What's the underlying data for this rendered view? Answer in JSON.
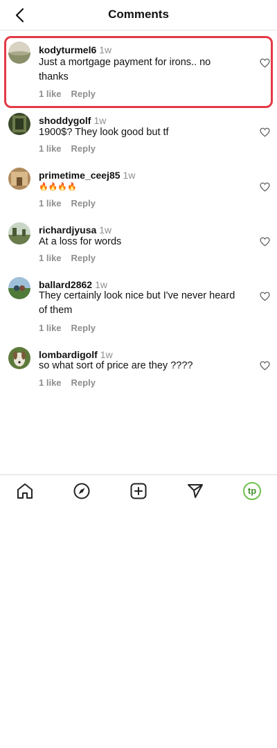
{
  "header": {
    "title": "Comments"
  },
  "comments": [
    {
      "username": "kodyturmel6",
      "time": "1w",
      "text": "Just a mortgage payment for irons.. no thanks",
      "likes": "1 like",
      "reply": "Reply"
    },
    {
      "username": "shoddygolf",
      "time": "1w",
      "text": "1900$? They look good but tf",
      "likes": "1 like",
      "reply": "Reply"
    },
    {
      "username": "primetime_ceej85",
      "time": "1w",
      "text": "🔥🔥🔥🔥",
      "likes": "1 like",
      "reply": "Reply"
    },
    {
      "username": "richardjyusa",
      "time": "1w",
      "text": "At a loss for words",
      "likes": "1 like",
      "reply": "Reply"
    },
    {
      "username": "ballard2862",
      "time": "1w",
      "text": "They certainly look nice but I've never heard of them",
      "likes": "1 like",
      "reply": "Reply"
    },
    {
      "username": "lombardigolf",
      "time": "1w",
      "text": "so what sort of price are they ????",
      "likes": "1 like",
      "reply": "Reply"
    }
  ],
  "nav": {
    "items": [
      "home-icon",
      "explore-compass-icon",
      "create-plus-icon",
      "direct-send-icon",
      "profile-tp-icon"
    ],
    "profile_badge": "tp",
    "accent": "#6cc24a"
  },
  "highlight_color": "#e53945"
}
